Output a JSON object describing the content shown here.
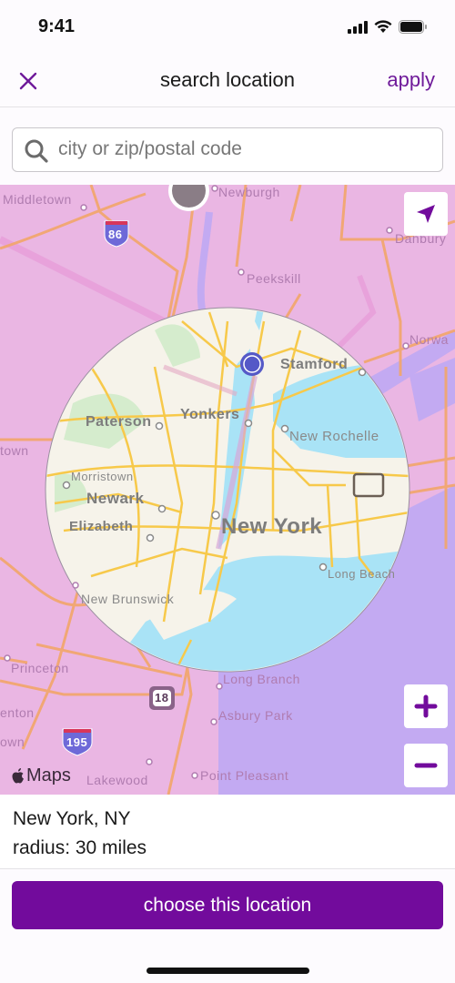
{
  "status_bar": {
    "time": "9:41"
  },
  "nav": {
    "title": "search location",
    "apply_label": "apply"
  },
  "search": {
    "placeholder": "city or zip/postal code",
    "value": ""
  },
  "map": {
    "labels": {
      "middletown": "Middletown",
      "newburgh": "Newburgh",
      "danbury": "Danbury",
      "peekskill": "Peekskill",
      "norwalk": "Norwa",
      "stamford": "Stamford",
      "paterson": "Paterson",
      "yonkers": "Yonkers",
      "new_rochelle": "New Rochelle",
      "morristown": "Morristown",
      "newark": "Newark",
      "elizabeth": "Elizabeth",
      "new_york": "New York",
      "long_beach": "Long Beach",
      "new_brunswick": "New Brunswick",
      "princeton": "Princeton",
      "long_branch": "Long Branch",
      "asbury_park": "Asbury Park",
      "point_pleasant": "Point Pleasant",
      "lakewood": "Lakewood",
      "trenton": "enton",
      "edge_town": "own",
      "edge_town2": "town",
      "route_86": "86",
      "route_18": "18",
      "route_195": "195"
    },
    "attribution": "Maps",
    "search_radius_miles": 30,
    "colors": {
      "outside_radius_land": "#eab6e3",
      "outside_radius_water": "#c3aaf2",
      "inside_land": "#f6f3ea",
      "inside_water": "#a9e3f6",
      "accent": "#720b9c"
    }
  },
  "selection": {
    "location": "New York, NY",
    "radius_label": "radius: 30 miles"
  },
  "actions": {
    "choose_label": "choose this location"
  }
}
